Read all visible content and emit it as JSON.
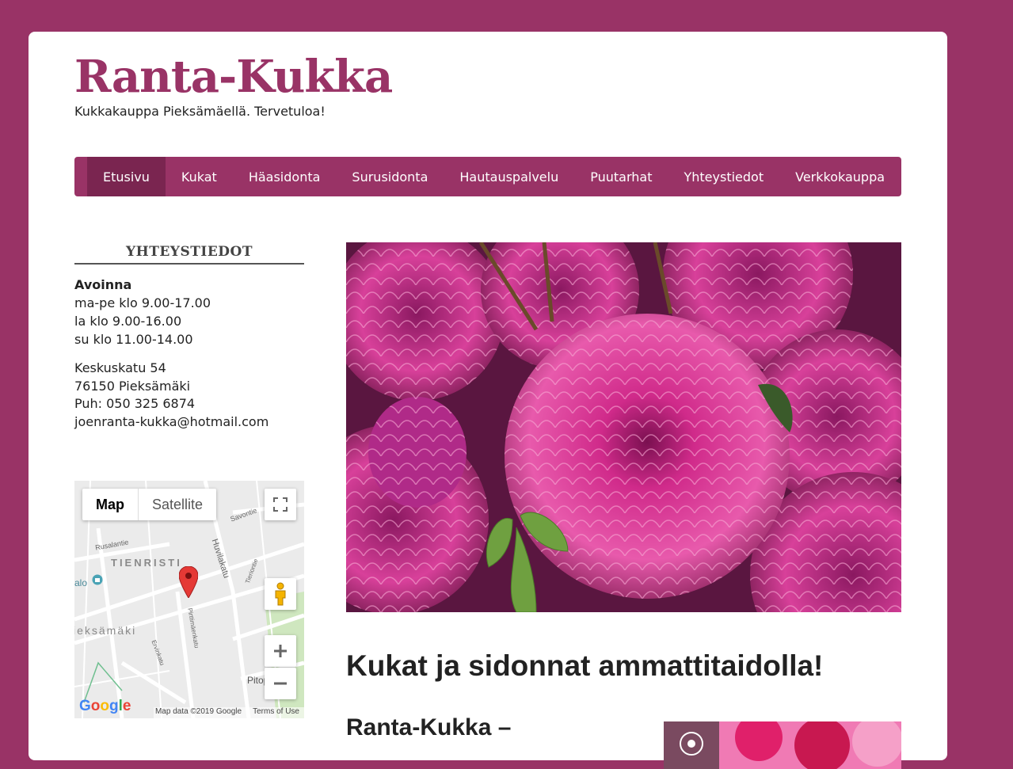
{
  "site": {
    "title": "Ranta-Kukka",
    "tagline": "Kukkakauppa Pieksämäellä. Tervetuloa!",
    "brand_color": "#993366"
  },
  "nav": {
    "items": [
      {
        "label": "Etusivu",
        "active": true
      },
      {
        "label": "Kukat"
      },
      {
        "label": "Häasidonta"
      },
      {
        "label": "Surusidonta"
      },
      {
        "label": "Hautauspalvelu"
      },
      {
        "label": "Puutarhat"
      },
      {
        "label": "Yhteystiedot"
      },
      {
        "label": "Verkkokauppa"
      }
    ]
  },
  "sidebar": {
    "widget_title": "YHTEYSTIEDOT",
    "hours_label": "Avoinna",
    "hours": [
      "ma-pe klo 9.00-17.00",
      "la klo 9.00-16.00",
      "su klo 11.00-14.00"
    ],
    "address": [
      "Keskuskatu 54",
      "76150 Pieksämäki",
      "Puh: 050 325 6874",
      "joenranta-kukka@hotmail.com"
    ]
  },
  "map": {
    "type_map": "Map",
    "type_satellite": "Satellite",
    "labels": {
      "district": "TIENRISTI",
      "town": "ieksämäki",
      "huvilakatu": "Huvilakatu",
      "savontie": "Savontie",
      "rusalantie": "Rusalantie",
      "pirttimakatu": "Pirttimäenkatu",
      "pitopalvelu": "Pitopalvelu",
      "alo": "alo",
      "tieriontie": "Tieriontie",
      "ervikatu": "Ervinkatu"
    },
    "google": "Google",
    "data": "Map data ©2019 Google",
    "terms": "Terms of Use",
    "icons": [
      "fullscreen-icon",
      "pegman-icon",
      "zoom-in-icon",
      "zoom-out-icon",
      "map-pin-icon"
    ]
  },
  "main": {
    "heading": "Kukat ja sidonnat ammattitaidolla!",
    "subheading": "Ranta-Kukka –"
  }
}
